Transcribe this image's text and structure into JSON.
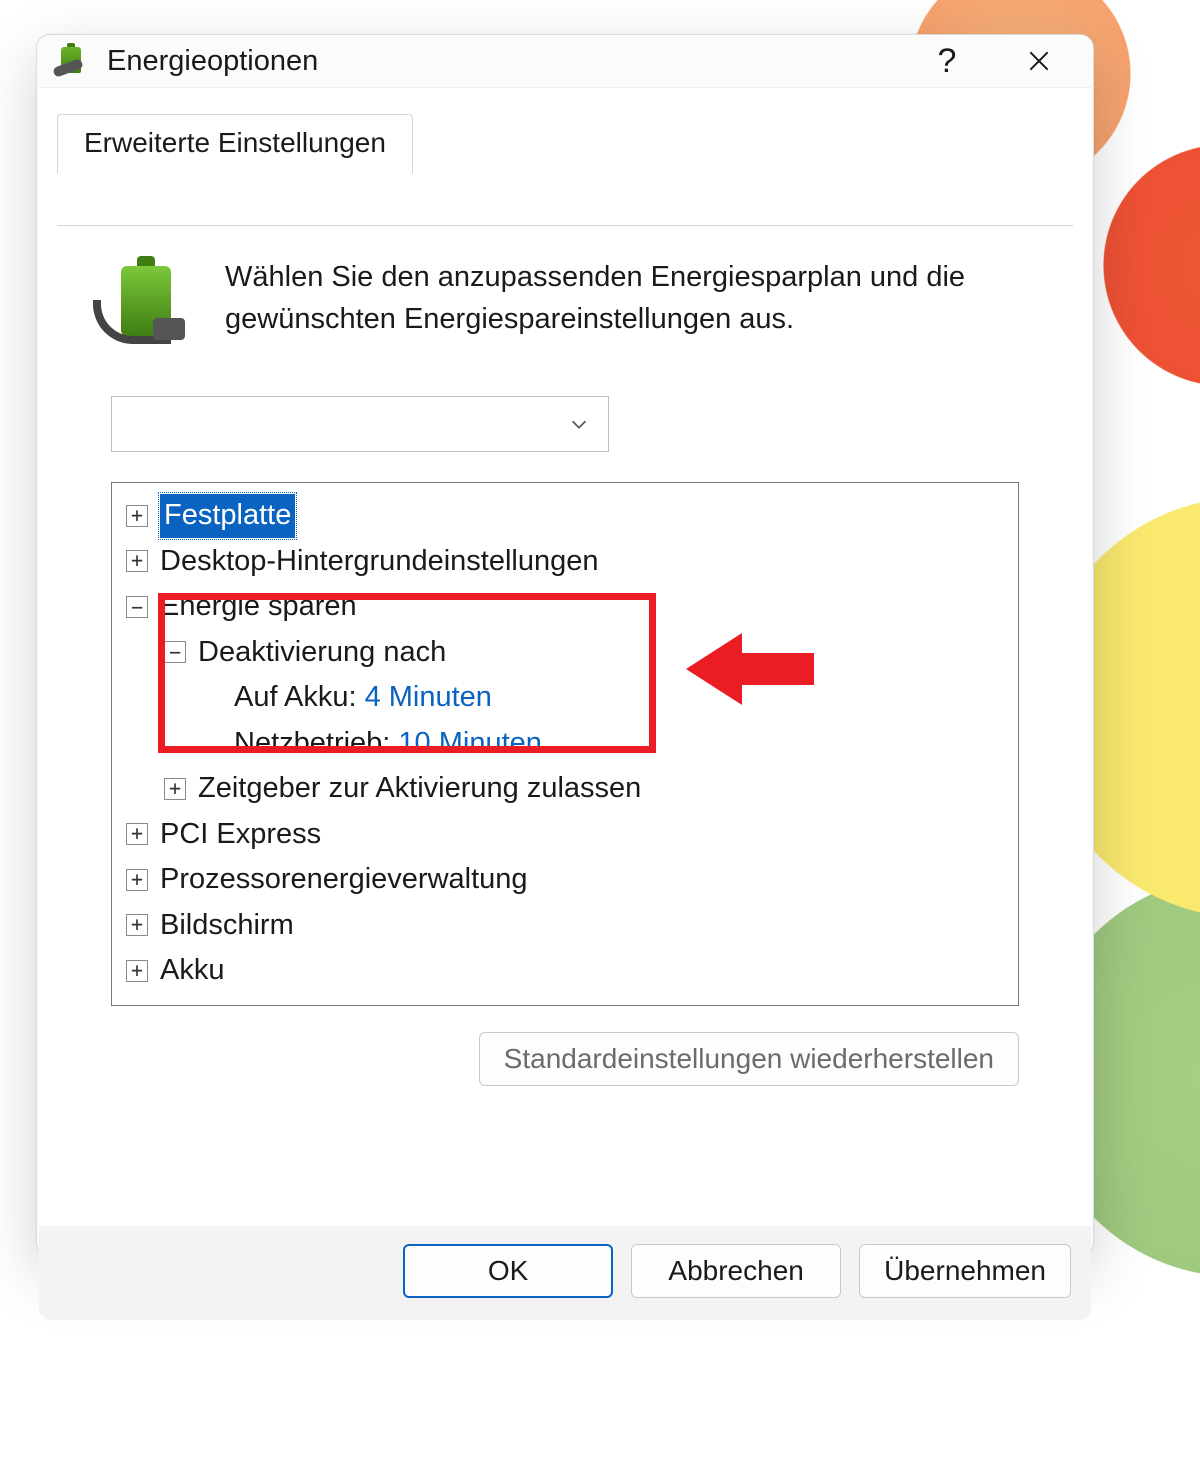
{
  "window": {
    "title": "Energieoptionen"
  },
  "tab": {
    "label": "Erweiterte Einstellungen"
  },
  "intro": {
    "text": "Wählen Sie den anzupassenden Energiesparplan und die gewünschten Energiespareinstellungen aus."
  },
  "plan_dropdown": {
    "selected": ""
  },
  "tree": {
    "festplatte": {
      "label": "Festplatte"
    },
    "desktop_bg": {
      "label": "Desktop-Hintergrundeinstellungen"
    },
    "energie_sparen": {
      "label": "Energie sparen"
    },
    "deaktivierung_nach": {
      "label": "Deaktivierung nach"
    },
    "auf_akku": {
      "label": "Auf Akku:",
      "value": "4 Minuten"
    },
    "netzbetrieb": {
      "label": "Netzbetrieb:",
      "value": "10 Minuten"
    },
    "zeitgeber": {
      "label": "Zeitgeber zur Aktivierung zulassen"
    },
    "pci_express": {
      "label": "PCI Express"
    },
    "prozessor": {
      "label": "Prozessorenergieverwaltung"
    },
    "bildschirm": {
      "label": "Bildschirm"
    },
    "akku": {
      "label": "Akku"
    }
  },
  "buttons": {
    "restore_defaults": "Standardeinstellungen wiederherstellen",
    "ok": "OK",
    "cancel": "Abbrechen",
    "apply": "Übernehmen"
  }
}
